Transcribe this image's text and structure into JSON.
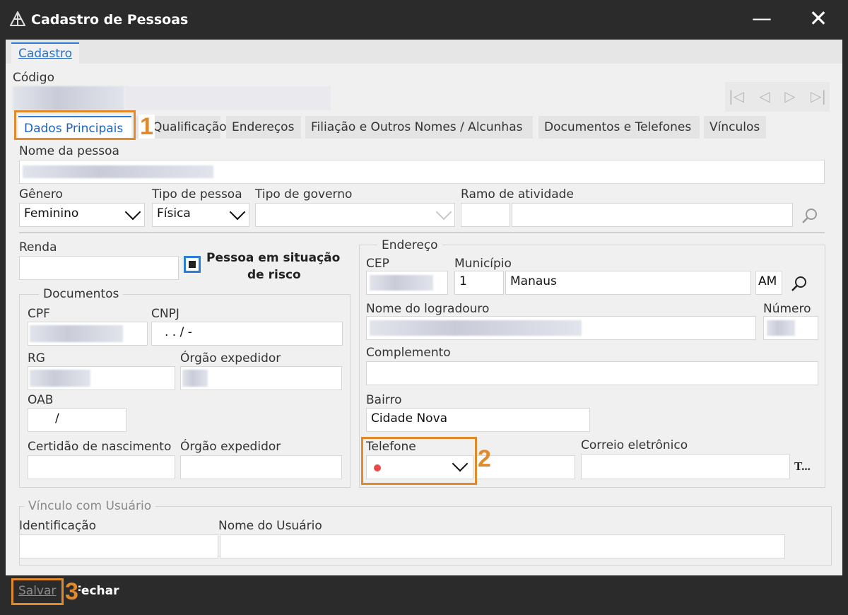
{
  "window": {
    "title": "Cadastro de Pessoas"
  },
  "outer_tab": "Cadastro",
  "codigo": {
    "label": "Código",
    "value": "",
    "name_value": ""
  },
  "nav": {
    "first": "|◁",
    "prev": "◁",
    "next": "▷",
    "last": "▷|"
  },
  "tabs": [
    "Dados Principais",
    "Qualificação",
    "Endereços",
    "Filiação e Outros Nomes / Alcunhas",
    "Documentos e Telefones",
    "Vínculos"
  ],
  "nome_pessoa": {
    "label": "Nome da pessoa",
    "value": ""
  },
  "genero": {
    "label": "Gênero",
    "value": "Feminino"
  },
  "tipo_pessoa": {
    "label": "Tipo de pessoa",
    "value": "Física"
  },
  "tipo_governo": {
    "label": "Tipo de governo",
    "value": ""
  },
  "ramo_atividade": {
    "label": "Ramo de atividade",
    "code": "",
    "value": ""
  },
  "renda": {
    "label": "Renda",
    "value": ""
  },
  "risco": {
    "label_line1": "Pessoa em situação",
    "label_line2": "de risco"
  },
  "documentos": {
    "title": "Documentos",
    "cpf_label": "CPF",
    "cpf_value": "",
    "cnpj_label": "CNPJ",
    "cnpj_value": ". . /   -",
    "rg_label": "RG",
    "rg_value": "",
    "orgao_label": "Órgão expedidor",
    "orgao_value": "",
    "oab_label": "OAB",
    "oab_value": "/",
    "certidao_label": "Certidão de nascimento",
    "certidao_value": "",
    "orgao2_label": "Órgão expedidor",
    "orgao2_value": ""
  },
  "endereco": {
    "title": "Endereço",
    "cep_label": "CEP",
    "cep_value": "",
    "municipio_label": "Município",
    "municipio_code": "1",
    "municipio_value": "Manaus",
    "uf": "AM",
    "logradouro_label": "Nome do logradouro",
    "logradouro_value": "",
    "numero_label": "Número",
    "numero_value": "",
    "complemento_label": "Complemento",
    "complemento_value": "",
    "bairro_label": "Bairro",
    "bairro_value": "Cidade Nova",
    "telefone_label": "Telefone",
    "telefone_value": "",
    "telefone_dot_color": "#e84a4a",
    "correio_label": "Correio eletrônico",
    "correio_value": "",
    "correio_extra": "T..."
  },
  "vinculo": {
    "title": "Vínculo com Usuário",
    "ident_label": "Identificação",
    "ident_value": "",
    "nome_label": "Nome do Usuário",
    "nome_value": ""
  },
  "footer": {
    "save": "Salvar",
    "close": "Fechar"
  },
  "badges": [
    "1",
    "2",
    "3"
  ],
  "colors": {
    "accent": "#2a7fd4",
    "highlight": "#e08a2c"
  }
}
